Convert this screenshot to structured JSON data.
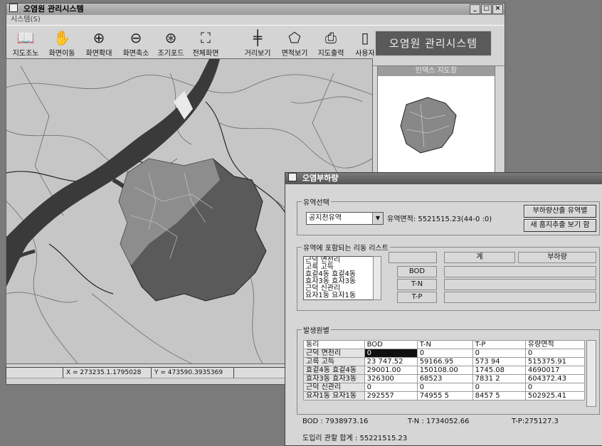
{
  "main_window": {
    "title": "오염원 관리시스템",
    "menu": "시스템(S)",
    "toolbar": [
      "지도조노",
      "화면이동",
      "화면확대",
      "화면축소",
      "조기포드",
      "전체화면",
      "거리보기",
      "면적보기",
      "지도출력",
      "사용자"
    ],
    "brand": "오염원 관리시스템",
    "minimap_title": "인덱스 지도창",
    "status_x": "X = 273235.1.1795028",
    "status_y": "Y = 473590.3935369"
  },
  "dialog": {
    "title": "오염부하량",
    "basin_group": "유역선택",
    "basin_selected": "공지천유역",
    "basin_area_text": "유역면적: 5521515.23(44-0 :0)",
    "btn_calc": "부하량산출 유역별",
    "btn_report": "새 홈지추출 보기 함",
    "admin_group": "유역에 포함되는 리동 리스트",
    "admin_list": [
      "근덕 면천리",
      "고륵 고득",
      "효겉4동 효겉4동",
      "효자3동 효자3동",
      "근덕 신관리",
      "요자1동 요자1동"
    ],
    "load_row_labels": [
      "BOD",
      "T-N",
      "T-P"
    ],
    "load_col_headers": [
      "계",
      "부하량"
    ],
    "table_group": "발생원별",
    "table_headers": [
      "동리",
      "BOD",
      "T-N",
      "T-P",
      "유량면적"
    ],
    "table_rows": [
      [
        "근덕 면천리",
        "0",
        "0",
        "0",
        "0"
      ],
      [
        "고륵 고득",
        "23 747.52",
        "59166.95",
        "573 94",
        "515375.91"
      ],
      [
        "효겉4동 효겉4동",
        "29001.00",
        "150108.00",
        "1745.08",
        "4690017"
      ],
      [
        "효자3동 효자3동",
        "326300",
        "68523",
        "7831 2",
        "604372.43"
      ],
      [
        "근덕 신관리",
        "0",
        "0",
        "0",
        "0"
      ],
      [
        "요자1동 요자1동",
        "292557",
        "74955 5",
        "8457 5",
        "502925.41"
      ]
    ],
    "sum_bod": "BOD : 7938973.16",
    "sum_tn": "T-N : 1734052.66",
    "sum_tp": "T-P:275127.3",
    "total_area": "도입리 관할 합계 : 55221515.23"
  }
}
